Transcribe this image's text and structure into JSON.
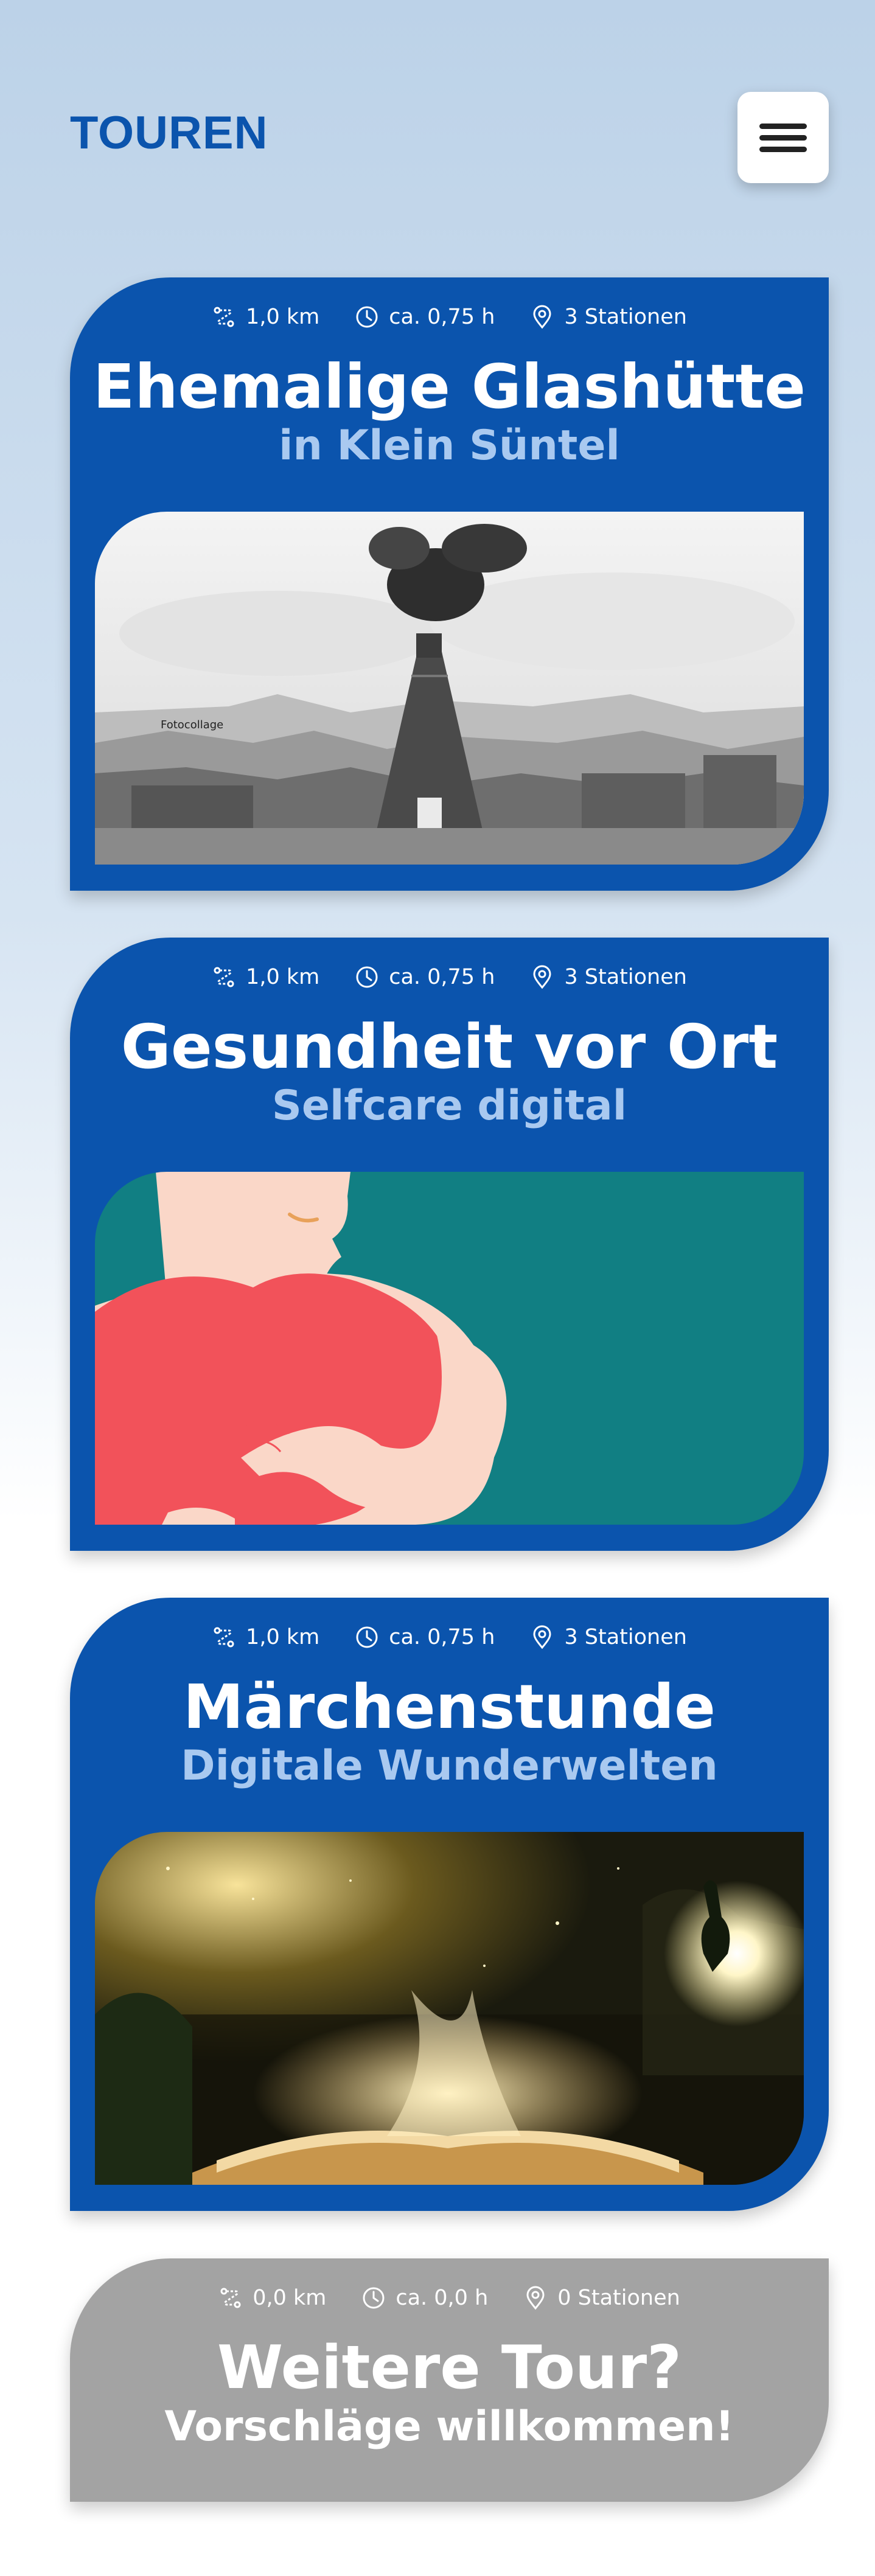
{
  "header": {
    "title": "TOUREN",
    "menu_icon": "hamburger-menu-icon"
  },
  "colors": {
    "brand_blue": "#0b54ad",
    "subtitle_blue": "#a9c9f0",
    "grey_card": "#a3a3a3",
    "teal": "#117f83",
    "heart_red": "#f2525a"
  },
  "tours": [
    {
      "distance": "1,0 km",
      "duration": "ca. 0,75 h",
      "stations": "3 Stationen",
      "title": "Ehemalige Glashütte",
      "subtitle": "in Klein Süntel",
      "image_caption": "Fotocollage",
      "image_description": "glass-furnace-photocollage"
    },
    {
      "distance": "1,0 km",
      "duration": "ca. 0,75 h",
      "stations": "3 Stationen",
      "title": "Gesundheit vor Ort",
      "subtitle": "Selfcare digital",
      "image_description": "person-hugging-heart-illustration"
    },
    {
      "distance": "1,0 km",
      "duration": "ca. 0,75 h",
      "stations": "3 Stationen",
      "title": "Märchenstunde",
      "subtitle": "Digitale Wunderwelten",
      "image_description": "magic-book-fairy-forest"
    },
    {
      "distance": "0,0 km",
      "duration": "ca. 0,0 h",
      "stations": "0 Stationen",
      "title": "Weitere Tour?",
      "subtitle": "Vorschläge willkommen!"
    }
  ],
  "icons": {
    "distance": "route-icon",
    "duration": "clock-icon",
    "stations": "map-pin-icon"
  }
}
